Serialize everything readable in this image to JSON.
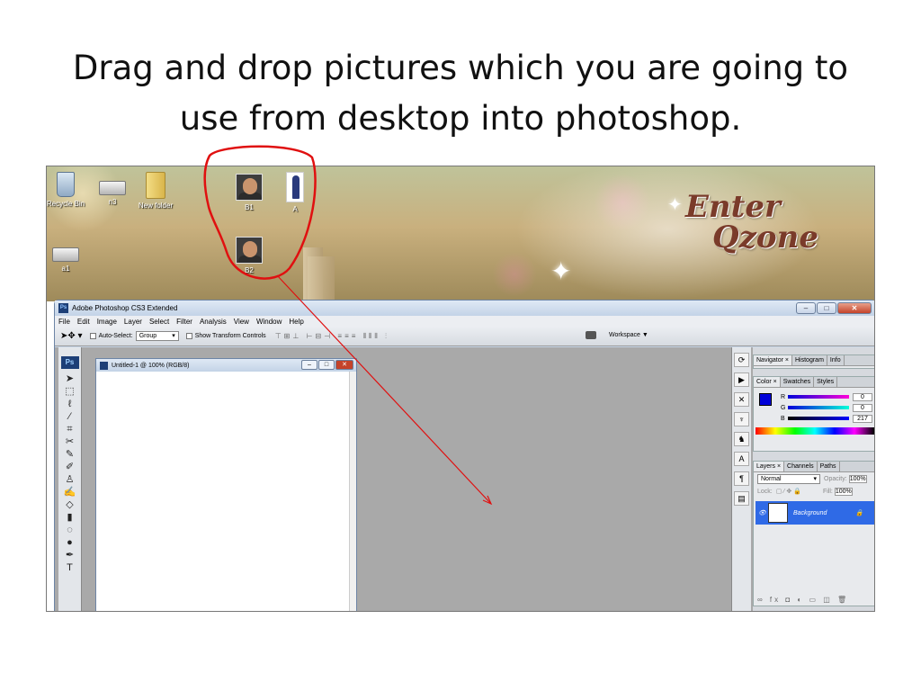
{
  "slide": {
    "title_line1": "Drag and drop pictures which you are going to",
    "title_line2": "use from desktop into photoshop."
  },
  "desktop": {
    "icons": [
      {
        "label": "Recycle Bin",
        "icon": "recycle-bin-icon"
      },
      {
        "label": "n3",
        "icon": "drive-icon"
      },
      {
        "label": "New folder",
        "icon": "folder-icon"
      },
      {
        "label": "B1",
        "icon": "photo-icon"
      },
      {
        "label": "A",
        "icon": "photo-icon"
      },
      {
        "label": "B2",
        "icon": "photo-icon"
      },
      {
        "label": "a1",
        "icon": "drive-icon"
      }
    ],
    "wallpaper_logo_line1": "Enter",
    "wallpaper_logo_line2": "Qzone"
  },
  "photoshop": {
    "window_title": "Adobe Photoshop CS3 Extended",
    "menu": [
      "File",
      "Edit",
      "Image",
      "Layer",
      "Select",
      "Filter",
      "Analysis",
      "View",
      "Window",
      "Help"
    ],
    "options_bar": {
      "auto_select_label": "Auto-Select:",
      "auto_select_value": "Group",
      "show_transform_label": "Show Transform Controls",
      "workspace_label": "Workspace ▼"
    },
    "document": {
      "title": "Untitled-1 @ 100% (RGB/8)"
    },
    "panels": {
      "navigator_tabs": [
        "Navigator ×",
        "Histogram",
        "Info"
      ],
      "color_tabs": [
        "Color ×",
        "Swatches",
        "Styles"
      ],
      "color": {
        "r_label": "R",
        "r": "0",
        "g_label": "G",
        "g": "0",
        "b_label": "B",
        "b": "217"
      },
      "layers_tabs": [
        "Layers ×",
        "Channels",
        "Paths"
      ],
      "layers": {
        "blend_mode": "Normal",
        "opacity_label": "Opacity:",
        "opacity": "100%",
        "lock_label": "Lock:",
        "fill_label": "Fill:",
        "fill": "100%",
        "layer_name": "Background"
      }
    },
    "ps_badge": "Ps"
  },
  "colors": {
    "annotation_red": "#e01010",
    "ps_blue": "#1d3f77",
    "layer_selected": "#2f6ae6",
    "foreground_color": "#0000d9"
  }
}
